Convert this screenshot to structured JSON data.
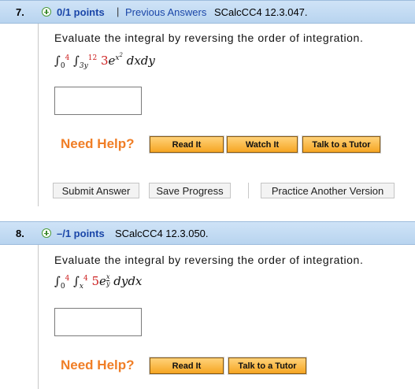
{
  "questions": [
    {
      "number": "7.",
      "points": "0/1 points",
      "separator": "|",
      "previous_answers": "Previous Answers",
      "code": "SCalcCC4 12.3.047.",
      "prompt": "Evaluate the integral by reversing the order of integration.",
      "integral": {
        "outer_lower": "0",
        "outer_upper": "4",
        "inner_lower": "3y",
        "inner_upper": "12",
        "integrand_coef": "3",
        "integrand_base": "e",
        "integrand_exp": "x",
        "integrand_exp_power": "2",
        "differentials": "dxdy"
      },
      "need_help": "Need Help?",
      "help_buttons": [
        "Read It",
        "Watch It",
        "Talk to a Tutor"
      ],
      "actions": {
        "submit": "Submit Answer",
        "save": "Save Progress",
        "practice": "Practice Another Version"
      }
    },
    {
      "number": "8.",
      "points": "–/1 points",
      "code": "SCalcCC4 12.3.050.",
      "prompt": "Evaluate the integral by reversing the order of integration.",
      "integral": {
        "outer_lower": "0",
        "outer_upper": "4",
        "inner_lower": "x",
        "inner_upper": "4",
        "integrand_coef": "5",
        "integrand_base": "e",
        "integrand_exp_num": "x",
        "integrand_exp_den": "y",
        "differentials": "dydx"
      },
      "need_help": "Need Help?",
      "help_buttons": [
        "Read It",
        "Talk to a Tutor"
      ]
    }
  ],
  "colors": {
    "header_bar": "#c4dcf3",
    "link_blue": "#1a46a8",
    "need_help_orange": "#f07e26",
    "help_button": "#f6a623",
    "integral_limit_red": "#cc1f1f"
  },
  "icons": {
    "expand": "plus-circle-icon",
    "integral": "integral-sign"
  }
}
